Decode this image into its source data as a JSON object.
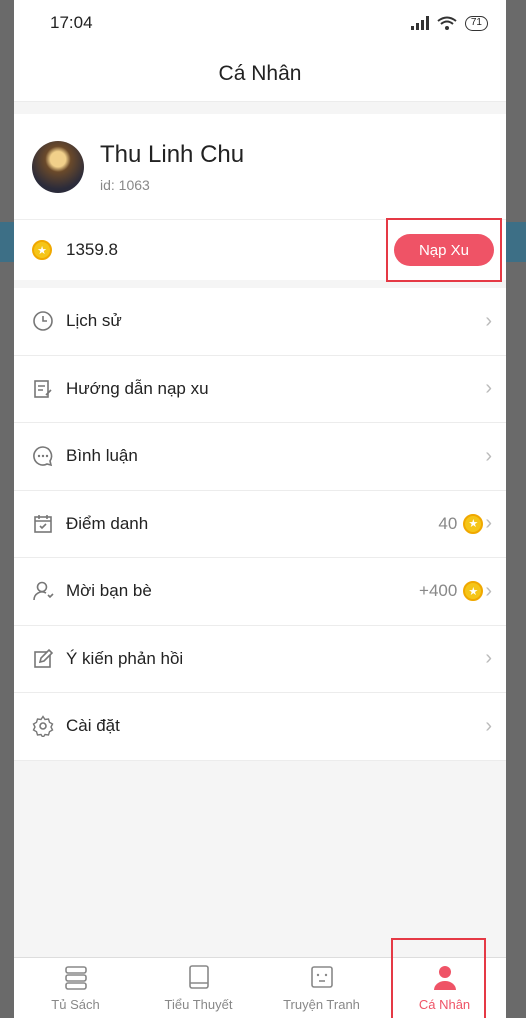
{
  "status_bar": {
    "time": "17:04",
    "battery": "71"
  },
  "header": {
    "title": "Cá Nhân"
  },
  "profile": {
    "name": "Thu Linh Chu",
    "id": "id: 1063"
  },
  "coins": {
    "amount": "1359.8",
    "recharge_label": "Nạp Xu"
  },
  "menu": {
    "items": [
      {
        "label": "Lịch sử",
        "icon": "clock-icon"
      },
      {
        "label": "Hướng dẫn nạp xu",
        "icon": "note-icon"
      },
      {
        "label": "Bình luận",
        "icon": "comment-icon"
      },
      {
        "label": "Điểm danh",
        "icon": "calendar-icon",
        "value": "40"
      },
      {
        "label": "Mời bạn bè",
        "icon": "user-invite-icon",
        "value": "+400"
      },
      {
        "label": "Ý kiến phản hồi",
        "icon": "edit-icon"
      },
      {
        "label": "Cài đặt",
        "icon": "gear-icon"
      }
    ]
  },
  "tabs": [
    {
      "label": "Tủ Sách",
      "icon": "bookshelf-icon"
    },
    {
      "label": "Tiểu Thuyết",
      "icon": "book-icon"
    },
    {
      "label": "Truyện Tranh",
      "icon": "comic-icon"
    },
    {
      "label": "Cá Nhân",
      "icon": "person-icon",
      "active": true
    }
  ],
  "colors": {
    "accent": "#ef5366",
    "coin": "#f5c518",
    "highlight_box": "#e53945"
  }
}
